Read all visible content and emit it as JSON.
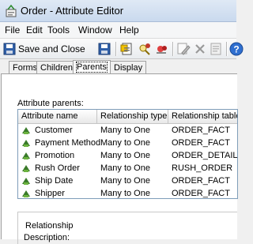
{
  "window": {
    "title": "Order - Attribute Editor",
    "icon": "attribute-editor-icon"
  },
  "menu": {
    "items": [
      "File",
      "Edit",
      "Tools",
      "Window",
      "Help"
    ]
  },
  "toolbar": {
    "save_close_label": "Save and Close"
  },
  "tabs": {
    "items": [
      "Forms",
      "Children",
      "Parents",
      "Display"
    ],
    "active": "Parents"
  },
  "parents": {
    "label": "Attribute parents:",
    "columns": [
      "Attribute name",
      "Relationship type",
      "Relationship table"
    ],
    "rows": [
      {
        "name": "Customer",
        "type": "Many to One",
        "table": "ORDER_FACT"
      },
      {
        "name": "Payment Method",
        "type": "Many to One",
        "table": "ORDER_FACT"
      },
      {
        "name": "Promotion",
        "type": "Many to One",
        "table": "ORDER_DETAIL"
      },
      {
        "name": "Rush Order",
        "type": "Many to One",
        "table": "RUSH_ORDER"
      },
      {
        "name": "Ship Date",
        "type": "Many to One",
        "table": "ORDER_FACT"
      },
      {
        "name": "Shipper",
        "type": "Many to One",
        "table": "ORDER_FACT"
      }
    ]
  },
  "relationship": {
    "title": "Relationship",
    "description_label": "Description:"
  },
  "colors": {
    "title_bar": "#dfe9f5",
    "grid_border": "#7f9db9",
    "attribute_icon": "#3a7a2a"
  }
}
